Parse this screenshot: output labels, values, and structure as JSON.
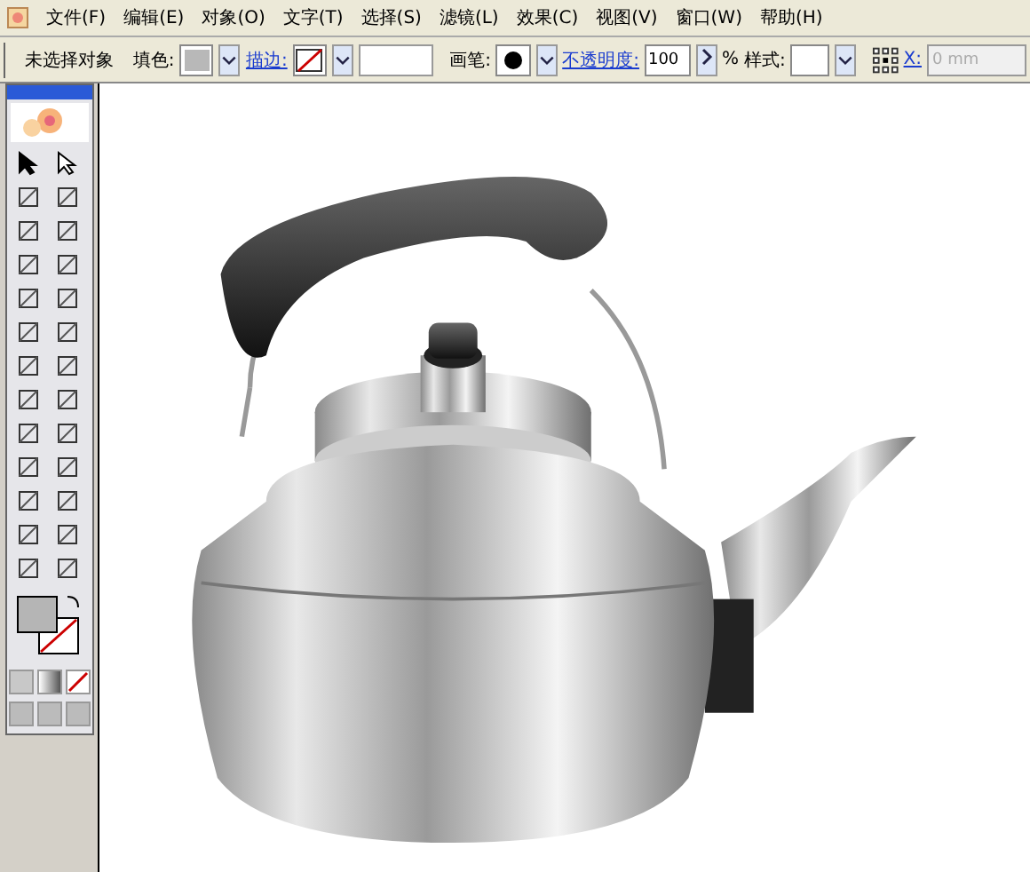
{
  "menu_bar": {
    "items": [
      {
        "label": "文件(F)"
      },
      {
        "label": "编辑(E)"
      },
      {
        "label": "对象(O)"
      },
      {
        "label": "文字(T)"
      },
      {
        "label": "选择(S)"
      },
      {
        "label": "滤镜(L)"
      },
      {
        "label": "效果(C)"
      },
      {
        "label": "视图(V)"
      },
      {
        "label": "窗口(W)"
      },
      {
        "label": "帮助(H)"
      }
    ]
  },
  "control_bar": {
    "status": "未选择对象",
    "fill_label": "填色:",
    "stroke_label": "描边:",
    "brush_label": "画笔:",
    "opacity_label": "不透明度:",
    "opacity_value": "100",
    "opacity_unit": "%",
    "style_label": "样式:",
    "x_label": "X:",
    "x_placeholder": "0 mm",
    "x_disabled": true
  }
}
